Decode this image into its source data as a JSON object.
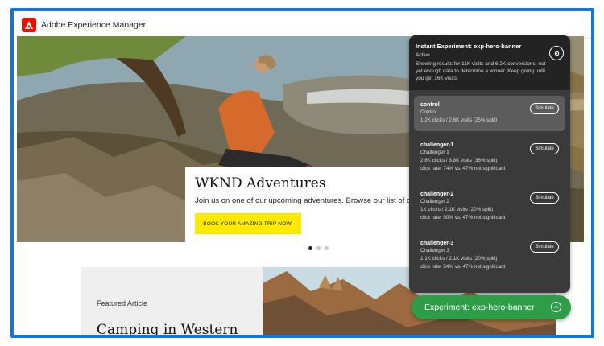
{
  "app": {
    "title": "Adobe Experience Manager"
  },
  "hero": {
    "title": "WKND Adventures",
    "description": "Join us on one of our upcoming adventures. Browse our list of curated e",
    "cta": "BOOK YOUR AMAZING TRIP NOW!"
  },
  "carousel": {
    "count": 3,
    "active": 0
  },
  "feature": {
    "label": "Featured Article",
    "title": "Camping in Western"
  },
  "experiment": {
    "title": "Instant Experiment: exp-hero-banner",
    "status": "Active",
    "note": "Showing results for 11K visits and 6.2K conversions: not yet enough data to determine a winner. Keep going until you get 16K visits.",
    "simulate_label": "Simulate",
    "variants": [
      {
        "name": "control",
        "label": "Control",
        "stats": "1.2K clicks / 2.6K visits (25% split)",
        "rate": ""
      },
      {
        "name": "challenger-1",
        "label": "Challenger 1",
        "stats": "2.8K clicks / 3.8K visits (36% split)",
        "rate": "click rate: 74% vs. 47% not significant"
      },
      {
        "name": "challenger-2",
        "label": "Challenger 2",
        "stats": "1K clicks / 2.1K visits (20% split)",
        "rate": "click rate: 50% vs. 47% not significant"
      },
      {
        "name": "challenger-3",
        "label": "Challenger 3",
        "stats": "1.1K clicks / 2.1K visits (20% split)",
        "rate": "click rate: 54% vs. 47% not significant"
      }
    ],
    "pill_label": "Experiment: exp-hero-banner"
  },
  "colors": {
    "frame": "#1473e6",
    "adobe_red": "#eb1000",
    "cta_yellow": "#ffea00",
    "pill_green": "#2d9d48",
    "panel_bg": "#3a3a3a"
  },
  "icons": {
    "logo": "adobe-logo-icon",
    "settings": "gear-icon",
    "toggle": "chevron-up-icon"
  }
}
